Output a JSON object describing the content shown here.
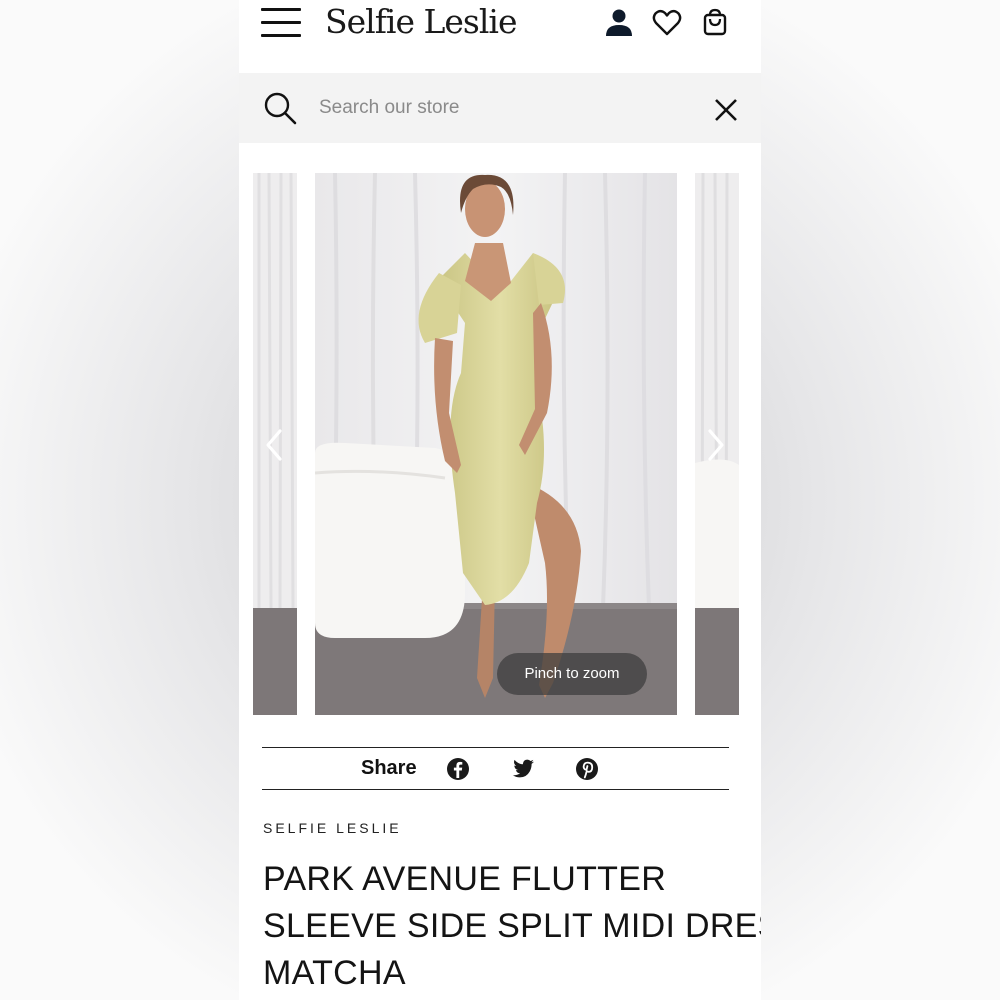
{
  "header": {
    "brand_logo": "Selfie Leslie",
    "icons": [
      "menu-icon",
      "account-icon",
      "heart-icon",
      "cart-icon"
    ]
  },
  "search": {
    "placeholder": "Search our store",
    "value": ""
  },
  "gallery": {
    "pinch_hint": "Pinch to zoom"
  },
  "share": {
    "label": "Share",
    "networks": [
      "facebook-icon",
      "twitter-icon",
      "pinterest-icon"
    ]
  },
  "product": {
    "brand": "SELFIE LESLIE",
    "title_lines": [
      "PARK AVENUE FLUTTER",
      "SLEEVE SIDE SPLIT MIDI DRESS",
      "MATCHA"
    ]
  },
  "colors": {
    "dress": "#d9d49a",
    "text": "#141414",
    "search_bg": "#f3f3f3"
  }
}
